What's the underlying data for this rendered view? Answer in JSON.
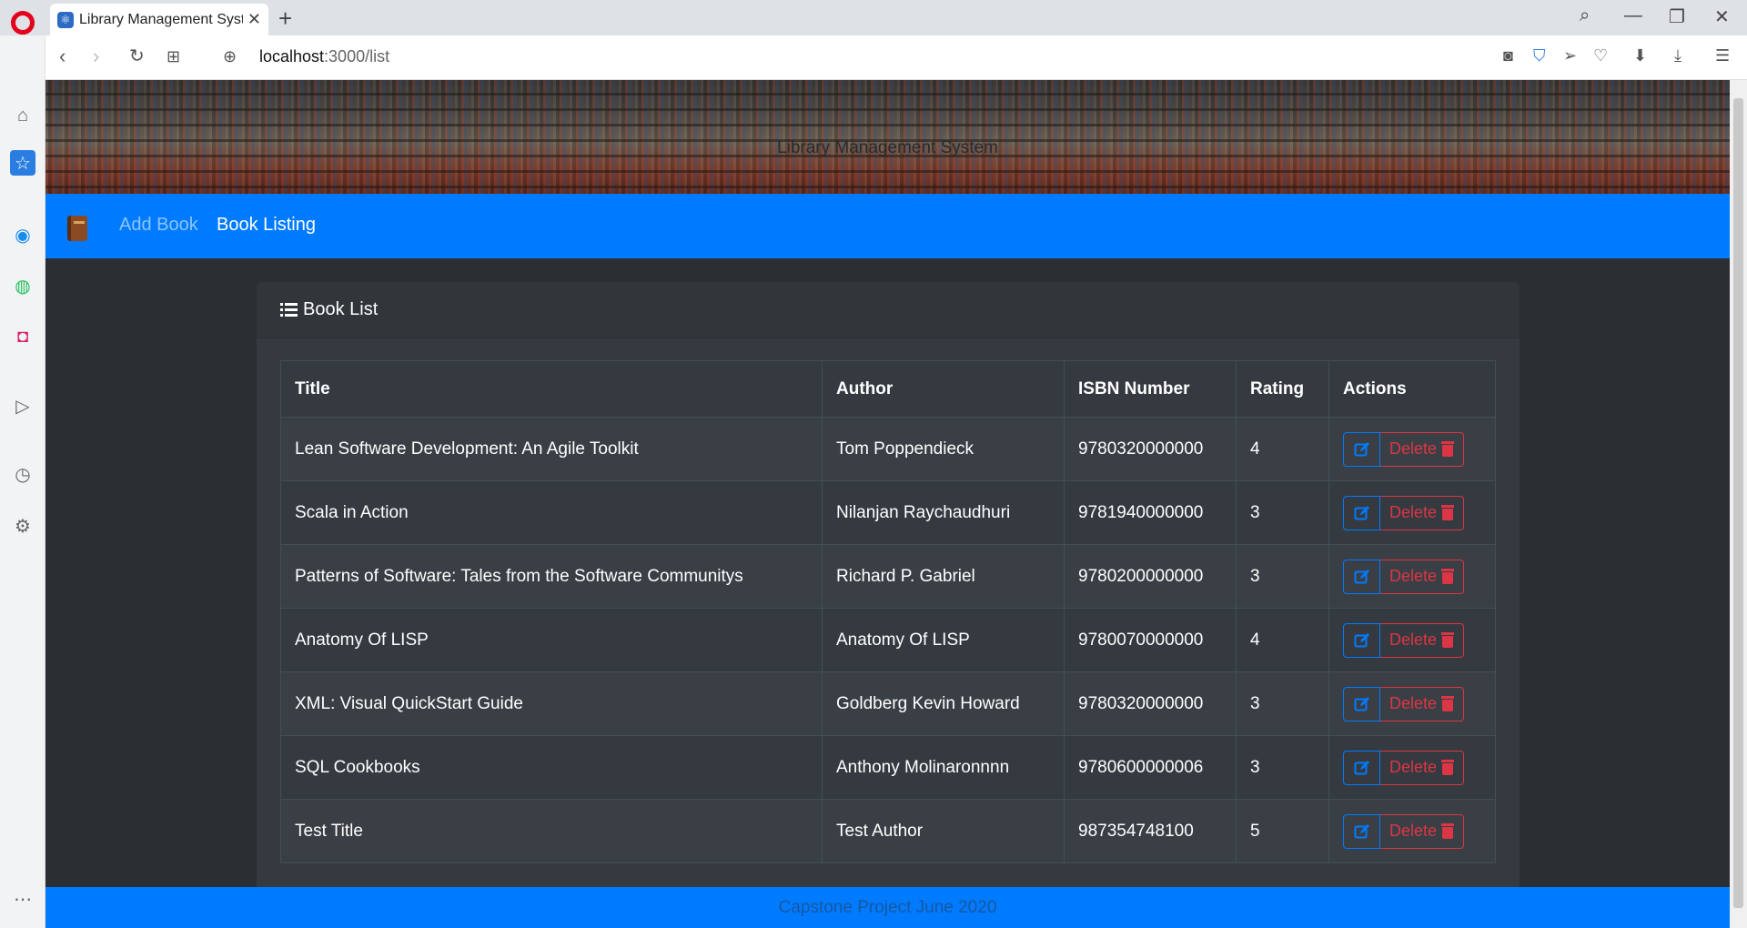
{
  "browser": {
    "tab_title": "Library Management System",
    "url_host": "localhost",
    "url_path": ":3000/list"
  },
  "banner": {
    "title": "Library Management System"
  },
  "navbar": {
    "add_label": "Add Book",
    "list_label": "Book Listing"
  },
  "card": {
    "title": "Book List"
  },
  "table": {
    "headers": {
      "title": "Title",
      "author": "Author",
      "isbn": "ISBN Number",
      "rating": "Rating",
      "actions": "Actions"
    },
    "delete_label": "Delete",
    "rows": [
      {
        "title": "Lean Software Development: An Agile Toolkit",
        "author": "Tom Poppendieck",
        "isbn": "9780320000000",
        "rating": "4"
      },
      {
        "title": "Scala in Action",
        "author": "Nilanjan Raychaudhuri",
        "isbn": "9781940000000",
        "rating": "3"
      },
      {
        "title": "Patterns of Software: Tales from the Software Communitys",
        "author": "Richard P. Gabriel",
        "isbn": "9780200000000",
        "rating": "3"
      },
      {
        "title": "Anatomy Of LISP",
        "author": "Anatomy Of LISP",
        "isbn": "9780070000000",
        "rating": "4"
      },
      {
        "title": "XML: Visual QuickStart Guide",
        "author": "Goldberg Kevin Howard",
        "isbn": "9780320000000",
        "rating": "3"
      },
      {
        "title": "SQL Cookbooks",
        "author": "Anthony Molinaronnnn",
        "isbn": "9780600000006",
        "rating": "3"
      },
      {
        "title": "Test Title",
        "author": "Test Author",
        "isbn": "987354748100",
        "rating": "5"
      }
    ]
  },
  "footer": {
    "text": "Capstone Project June 2020"
  },
  "colors": {
    "primary": "#007bff",
    "danger": "#dc3545",
    "card": "#343a40",
    "page": "#2b2e33"
  }
}
